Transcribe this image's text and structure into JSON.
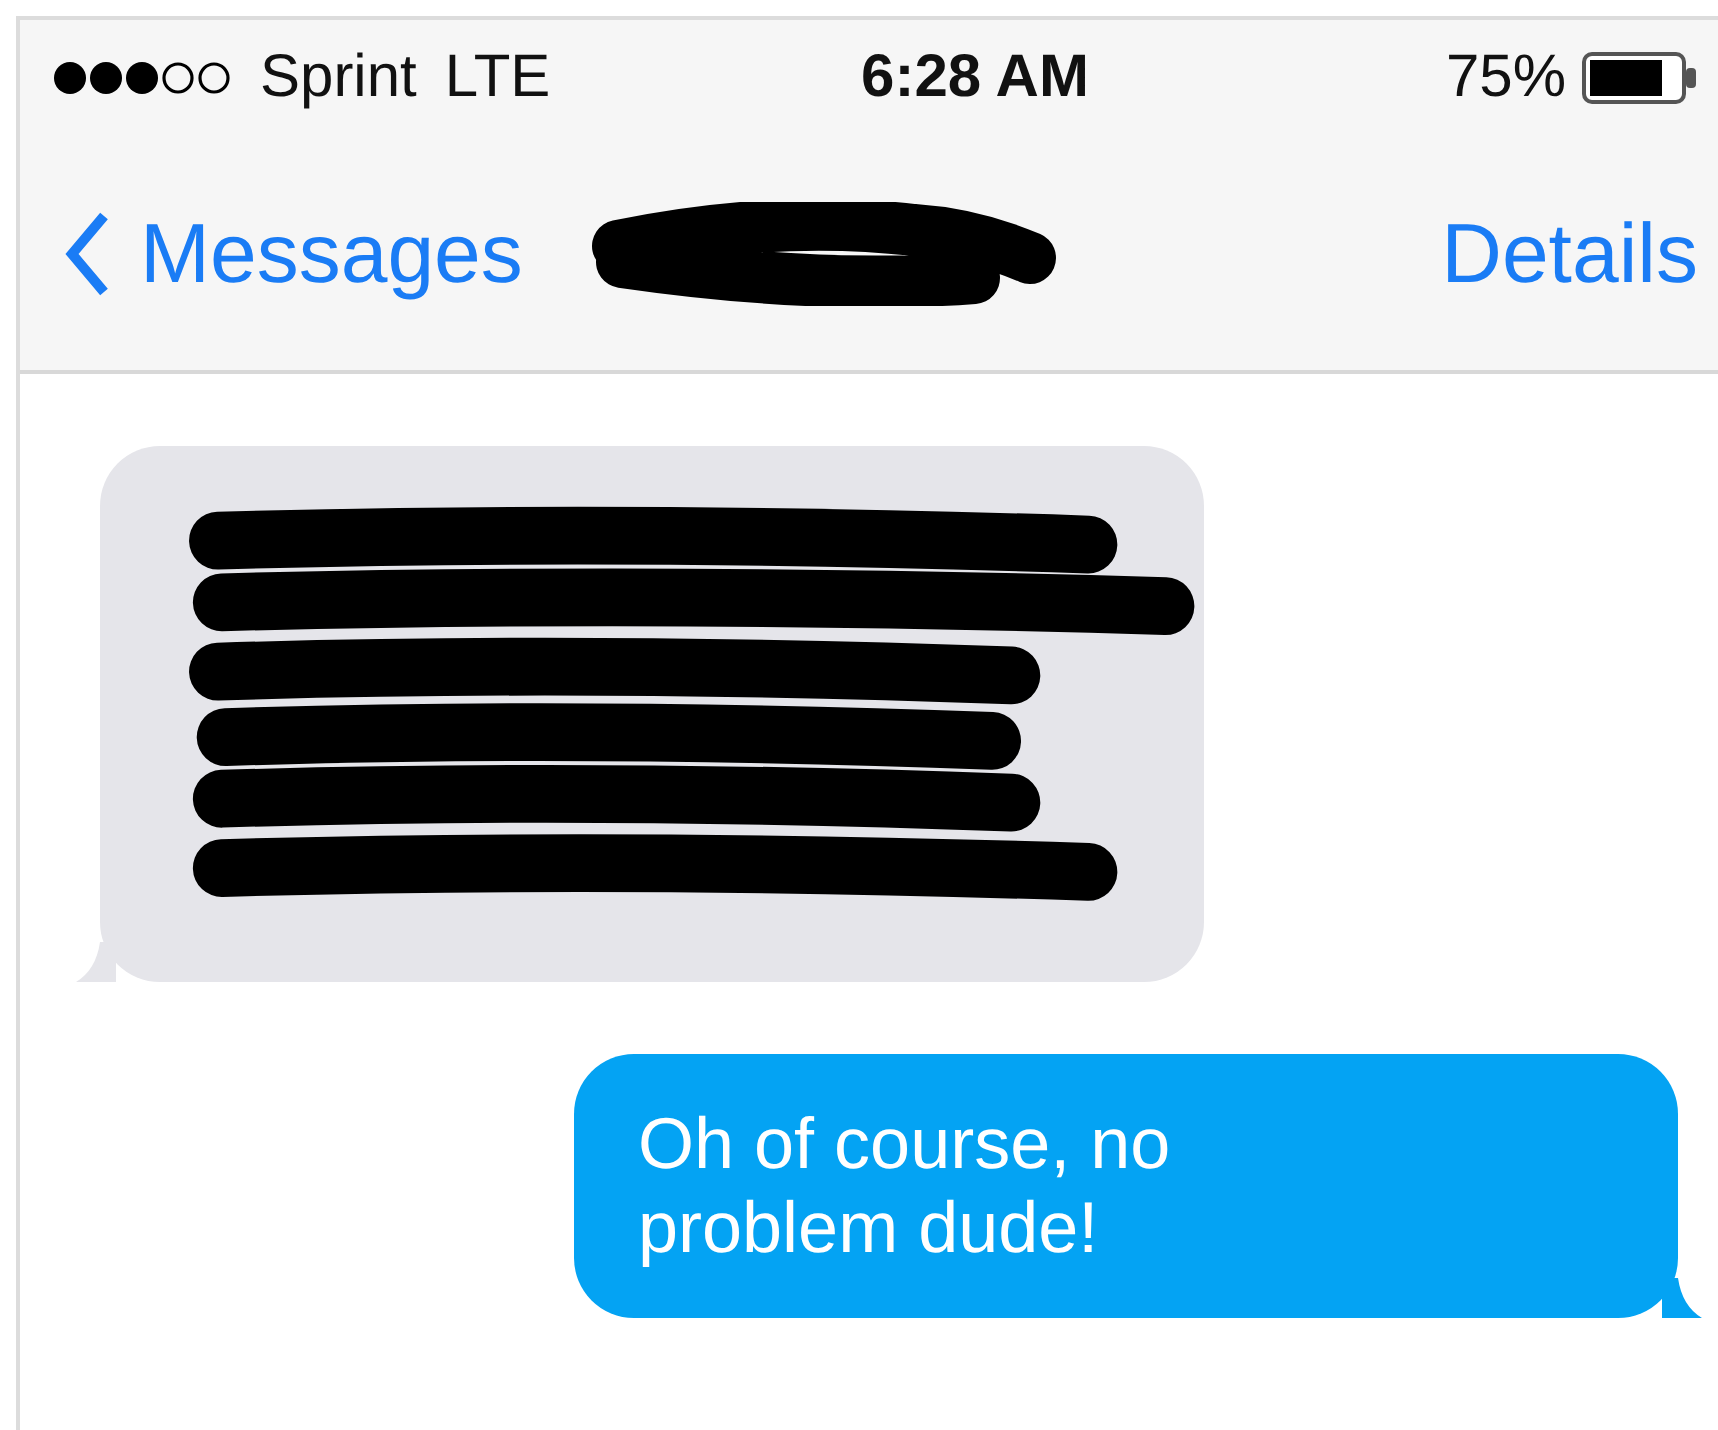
{
  "status_bar": {
    "carrier": "Sprint",
    "network": "LTE",
    "time": "6:28 AM",
    "battery": "75%"
  },
  "nav_bar": {
    "back": "Messages",
    "title": {
      "kind": "redacted"
    },
    "action": "Details"
  },
  "messages": [
    {
      "kind": "redacted",
      "outgoing": false
    },
    {
      "kind": "text",
      "outgoing": true,
      "text": "Oh of course, no problem dude!"
    }
  ]
}
